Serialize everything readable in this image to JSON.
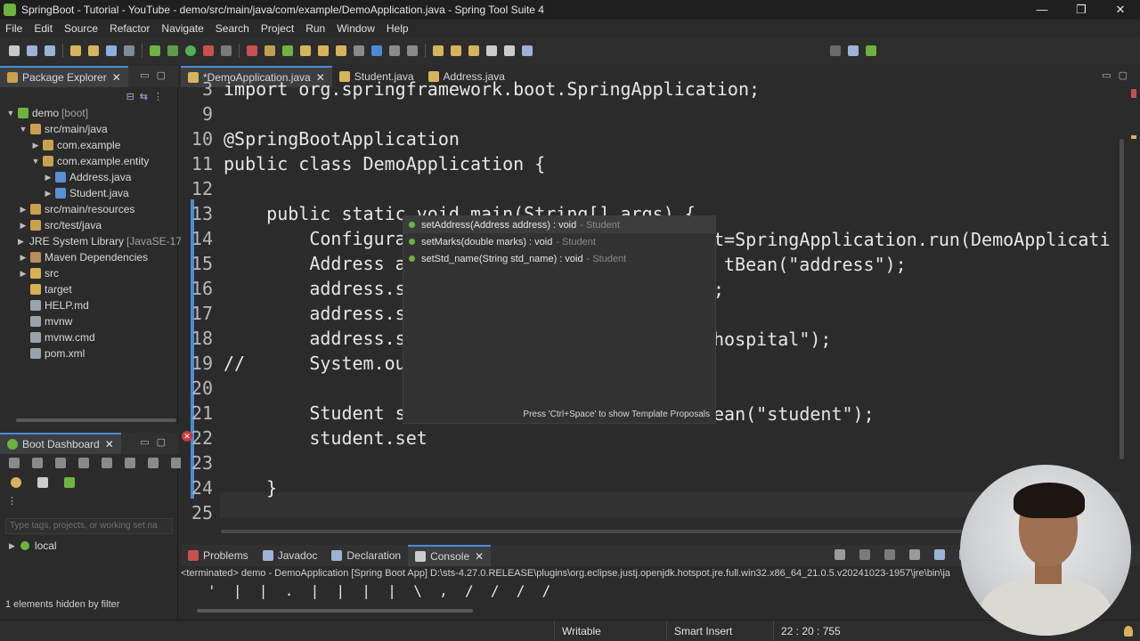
{
  "window": {
    "title": "SpringBoot - Tutorial - YouTube - demo/src/main/java/com/example/DemoApplication.java - Spring Tool Suite 4",
    "controls": [
      "—",
      "❐",
      "✕"
    ]
  },
  "menu": [
    "File",
    "Edit",
    "Source",
    "Refactor",
    "Navigate",
    "Search",
    "Project",
    "Run",
    "Window",
    "Help"
  ],
  "package_explorer": {
    "title": "Package Explorer",
    "tree": [
      {
        "label": "demo",
        "tag": "[boot]",
        "indent": 0,
        "expanded": true,
        "icon": "project-icon",
        "color": "#6db33f"
      },
      {
        "label": "src/main/java",
        "indent": 1,
        "expanded": true,
        "icon": "source-folder-icon",
        "color": "#c9a24e"
      },
      {
        "label": "com.example",
        "indent": 2,
        "expanded": false,
        "icon": "package-icon",
        "color": "#c9a24e"
      },
      {
        "label": "com.example.entity",
        "indent": 2,
        "expanded": true,
        "icon": "package-icon",
        "color": "#c9a24e"
      },
      {
        "label": "Address.java",
        "indent": 3,
        "expanded": false,
        "icon": "java-file-icon",
        "color": "#5b8fd6"
      },
      {
        "label": "Student.java",
        "indent": 3,
        "expanded": false,
        "icon": "java-file-icon",
        "color": "#5b8fd6"
      },
      {
        "label": "src/main/resources",
        "indent": 1,
        "expanded": false,
        "icon": "source-folder-icon",
        "color": "#c9a24e"
      },
      {
        "label": "src/test/java",
        "indent": 1,
        "expanded": false,
        "icon": "source-folder-icon",
        "color": "#c9a24e"
      },
      {
        "label": "JRE System Library",
        "tag": "[JavaSE-17",
        "indent": 1,
        "expanded": false,
        "icon": "library-icon",
        "color": "#b68f5b"
      },
      {
        "label": "Maven Dependencies",
        "indent": 1,
        "expanded": false,
        "icon": "library-icon",
        "color": "#b68f5b"
      },
      {
        "label": "src",
        "indent": 1,
        "expanded": false,
        "icon": "folder-icon",
        "color": "#d8b252"
      },
      {
        "label": "target",
        "indent": 1,
        "expanded": null,
        "icon": "folder-icon",
        "color": "#d8b252"
      },
      {
        "label": "HELP.md",
        "indent": 1,
        "expanded": null,
        "icon": "file-icon",
        "color": "#9aa3ad"
      },
      {
        "label": "mvnw",
        "indent": 1,
        "expanded": null,
        "icon": "file-icon",
        "color": "#9aa3ad"
      },
      {
        "label": "mvnw.cmd",
        "indent": 1,
        "expanded": null,
        "icon": "file-icon",
        "color": "#9aa3ad"
      },
      {
        "label": "pom.xml",
        "indent": 1,
        "expanded": null,
        "icon": "xml-file-icon",
        "color": "#9aa3ad"
      }
    ]
  },
  "boot_dashboard": {
    "title": "Boot Dashboard",
    "filter_placeholder": "Type tags, projects, or working set na",
    "local_label": "local",
    "hidden_note": "1 elements hidden by filter"
  },
  "editor": {
    "tabs": [
      {
        "label": "*DemoApplication.java",
        "active": true
      },
      {
        "label": "Student.java",
        "active": false
      },
      {
        "label": "Address.java",
        "active": false
      }
    ],
    "lines": [
      {
        "n": "3",
        "code": "import org.springframework.boot.SpringApplication;"
      },
      {
        "n": "9",
        "code": ""
      },
      {
        "n": "10",
        "code": "@SpringBootApplication"
      },
      {
        "n": "11",
        "code": "public class DemoApplication {"
      },
      {
        "n": "12",
        "code": ""
      },
      {
        "n": "13",
        "code": "    public static void main(String[] args) {"
      },
      {
        "n": "14",
        "code": "        Configura"
      },
      {
        "n": "15",
        "code": "        Address a"
      },
      {
        "n": "16",
        "code": "        address.s"
      },
      {
        "n": "17",
        "code": "        address.s"
      },
      {
        "n": "18",
        "code": "        address.s"
      },
      {
        "n": "19",
        "code": "//      System.ou"
      },
      {
        "n": "20",
        "code": ""
      },
      {
        "n": "21",
        "code": "        Student s"
      },
      {
        "n": "22",
        "code": "        student.set"
      },
      {
        "n": "23",
        "code": ""
      },
      {
        "n": "24",
        "code": "    }"
      },
      {
        "n": "25",
        "code": ""
      }
    ],
    "visible_tails": {
      "line14": "t=SpringApplication.run(DemoApplicati",
      "line15": "tBean(\"address\");",
      "line16": ";",
      "line18": "hospital\");",
      "line21": "ean(\"student\");"
    }
  },
  "content_assist": {
    "items": [
      {
        "signature": "setAddress(Address address) : void",
        "owner": "- Student",
        "selected": true
      },
      {
        "signature": "setMarks(double marks) : void",
        "owner": "- Student",
        "selected": false
      },
      {
        "signature": "setStd_name(String std_name) : void",
        "owner": "- Student",
        "selected": false
      }
    ],
    "hint": "Press 'Ctrl+Space' to show Template Proposals"
  },
  "console": {
    "tabs": [
      {
        "label": "Problems",
        "active": false
      },
      {
        "label": "Javadoc",
        "active": false
      },
      {
        "label": "Declaration",
        "active": false
      },
      {
        "label": "Console",
        "active": true
      }
    ],
    "terminated": "<terminated> demo - DemoApplication [Spring Boot App] D:\\sts-4.27.0.RELEASE\\plugins\\org.eclipse.justj.openjdk.hotspot.jre.full.win32.x86_64_21.0.5.v20241023-1957\\jre\\bin\\ja",
    "output": "'  |  |  .  |  |  |  |  \\  ,  /  /  /  /"
  },
  "status": {
    "writable": "Writable",
    "insert_mode": "Smart Insert",
    "position": "22 : 20 : 755"
  }
}
